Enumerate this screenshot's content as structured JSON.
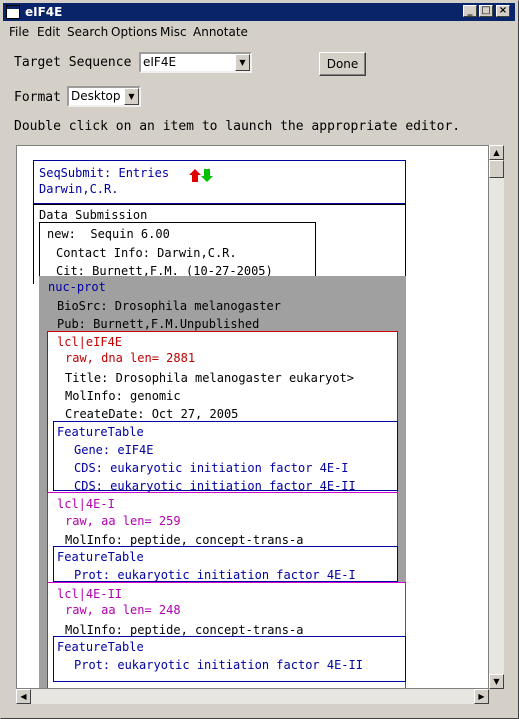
{
  "window": {
    "title": "eIF4E"
  },
  "menu": [
    "File",
    "Edit",
    "Search",
    "Options",
    "Misc",
    "Annotate"
  ],
  "controls": {
    "target_label": "Target Sequence",
    "target_value": "eIF4E",
    "done_label": "Done",
    "format_label": "Format",
    "format_value": "Desktop",
    "hint": "Double click on an item to launch the appropriate editor."
  },
  "tree": {
    "entries": {
      "title": "SeqSubmit: Entries",
      "author": "Darwin,C.R."
    },
    "submission": {
      "title": "Data Submission",
      "new_line": "new:  Sequin 6.00",
      "contact": "Contact Info: Darwin,C.R.",
      "cit": "Cit: Burnett,F.M. (10-27-2005)"
    },
    "nucprot": {
      "title": "nuc-prot",
      "biosrc": "BioSrc: Drosophila melanogaster",
      "pub": "Pub: Burnett,F.M.Unpublished"
    },
    "dna": {
      "id": "lcl|eIF4E",
      "raw": "raw, dna len= 2881",
      "title": "Title: Drosophila melanogaster eukaryot>",
      "molinfo": "MolInfo: genomic",
      "createdate": "CreateDate: Oct 27, 2005"
    },
    "ft1": {
      "title": "FeatureTable",
      "gene": "Gene: eIF4E",
      "cds1": "CDS: eukaryotic initiation factor 4E-I",
      "cds2": "CDS: eukaryotic initiation factor 4E-II"
    },
    "p1": {
      "id": "lcl|4E-I",
      "raw": "raw, aa len= 259",
      "molinfo": "MolInfo: peptide, concept-trans-a"
    },
    "ft2": {
      "title": "FeatureTable",
      "prot": "Prot: eukaryotic initiation factor 4E-I"
    },
    "p2": {
      "id": "lcl|4E-II",
      "raw": "raw, aa len= 248",
      "molinfo": "MolInfo: peptide, concept-trans-a"
    },
    "ft3": {
      "title": "FeatureTable",
      "prot": "Prot: eukaryotic initiation factor 4E-II"
    }
  },
  "icons": [
    "window-icon",
    "up-arrow-icon",
    "down-arrow-icon"
  ]
}
